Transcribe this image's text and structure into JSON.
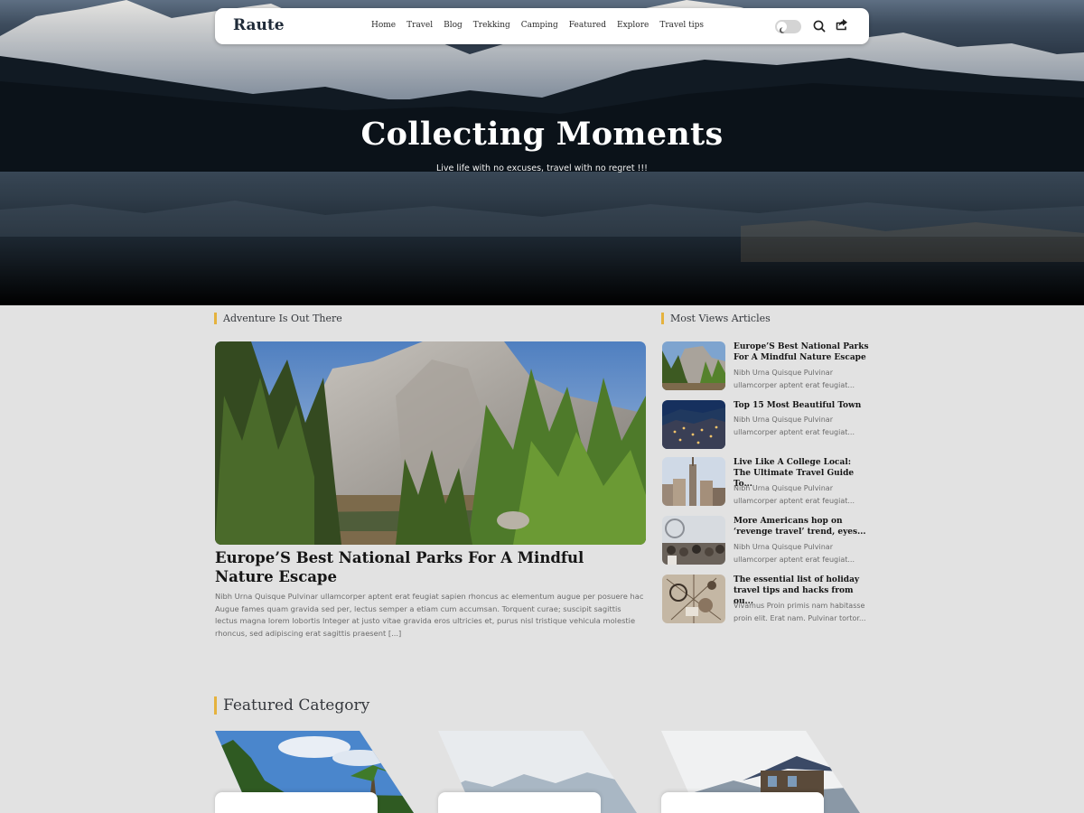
{
  "site": {
    "logo": "Raute"
  },
  "nav": {
    "items": [
      "Home",
      "Travel",
      "Blog",
      "Trekking",
      "Camping",
      "Featured",
      "Explore",
      "Travel tips"
    ]
  },
  "hero": {
    "title": "Collecting Moments",
    "subtitle": "Live life with no excuses, travel with no regret !!!"
  },
  "main": {
    "section_title": "Adventure Is Out There",
    "featured": {
      "title": "Europe’S Best National Parks For A Mindful Nature Escape",
      "excerpt": "Nibh Urna Quisque Pulvinar ullamcorper aptent erat feugiat sapien rhoncus ac elementum augue per posuere hac Augue fames quam gravida sed per, lectus semper a etiam cum accumsan. Torquent curae; suscipit sagittis lectus magna lorem lobortis Integer at justo vitae gravida eros ultricies et, purus nisl tristique vehicula molestie rhoncus, sed adipiscing erat sagittis praesent [...]"
    }
  },
  "sidebar": {
    "title": "Most Views Articles",
    "items": [
      {
        "title": "Europe’S Best National Parks For A Mindful Nature Escape",
        "excerpt": "Nibh Urna Quisque Pulvinar ullamcorper aptent erat feugiat..."
      },
      {
        "title": "Top 15 Most Beautiful Town",
        "excerpt": "Nibh Urna Quisque Pulvinar ullamcorper aptent erat feugiat..."
      },
      {
        "title": "Live Like A College Local: The Ultimate Travel Guide To...",
        "excerpt": "Nibh Urna Quisque Pulvinar ullamcorper aptent erat feugiat..."
      },
      {
        "title": "More Americans hop on ‘revenge travel’ trend, eyes...",
        "excerpt": "Nibh Urna Quisque Pulvinar ullamcorper aptent erat feugiat..."
      },
      {
        "title": "The essential list of holiday travel tips and hacks from ou...",
        "excerpt": "Vivamus Proin primis nam habitasse proin elit. Erat nam. Pulvinar tortor..."
      }
    ]
  },
  "featured_category": {
    "title": "Featured Category"
  },
  "icons": {
    "theme_toggle": "moon-icon",
    "search": "search-icon",
    "share": "share-icon"
  },
  "colors": {
    "accent": "#e5b23e",
    "background": "#e2e2e2",
    "header_bg": "#ffffff"
  }
}
